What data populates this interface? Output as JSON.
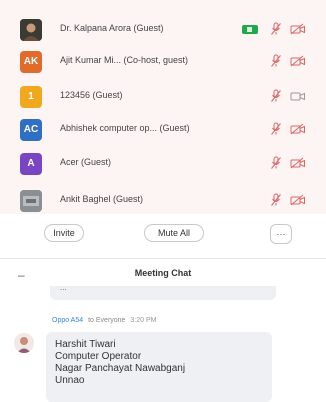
{
  "participants": [
    {
      "name": "Dr. Kalpana Arora (Guest)",
      "initials": "",
      "avatar_color": "#3c3a35",
      "photo": true,
      "video_badge": true
    },
    {
      "name": "Ajit  Kumar Mi... (Co-host, guest)",
      "initials": "AK",
      "avatar_color": "#e06b2a",
      "photo": false,
      "video_badge": false
    },
    {
      "name": "123456 (Guest)",
      "initials": "1",
      "avatar_color": "#f0a81e",
      "photo": false,
      "video_badge": false
    },
    {
      "name": "Abhishek computer op...  (Guest)",
      "initials": "AC",
      "avatar_color": "#2f6fc4",
      "photo": false,
      "video_badge": false
    },
    {
      "name": "Acer (Guest)",
      "initials": "A",
      "avatar_color": "#7a45c4",
      "photo": false,
      "video_badge": false
    },
    {
      "name": "Ankit Baghel (Guest)",
      "initials": "",
      "avatar_color": "#8a8f94",
      "photo": true,
      "video_badge": false
    }
  ],
  "actions": {
    "invite_label": "Invite",
    "mute_all_label": "Mute All",
    "more_label": "⋯"
  },
  "chat": {
    "collapse_symbol": "–",
    "title": "Meeting Chat",
    "previous_message_fragment": "...",
    "sender": "Oppo A54",
    "to": "to Everyone",
    "time": "3:20 PM",
    "message_lines": [
      "Harshit Tiwari",
      "Computer Operator",
      "Nagar Panchayat Nawabganj",
      "Unnao"
    ]
  },
  "colors": {
    "participant_panel_bg": "#fdf4f4",
    "muted_red": "#e06464",
    "video_on_green": "#1fa94b",
    "link_blue": "#3b86d6"
  },
  "icons": {
    "mic": "microphone-muted-icon",
    "camera": "video-camera-off-icon",
    "camera_on": "video-camera-on-icon"
  }
}
